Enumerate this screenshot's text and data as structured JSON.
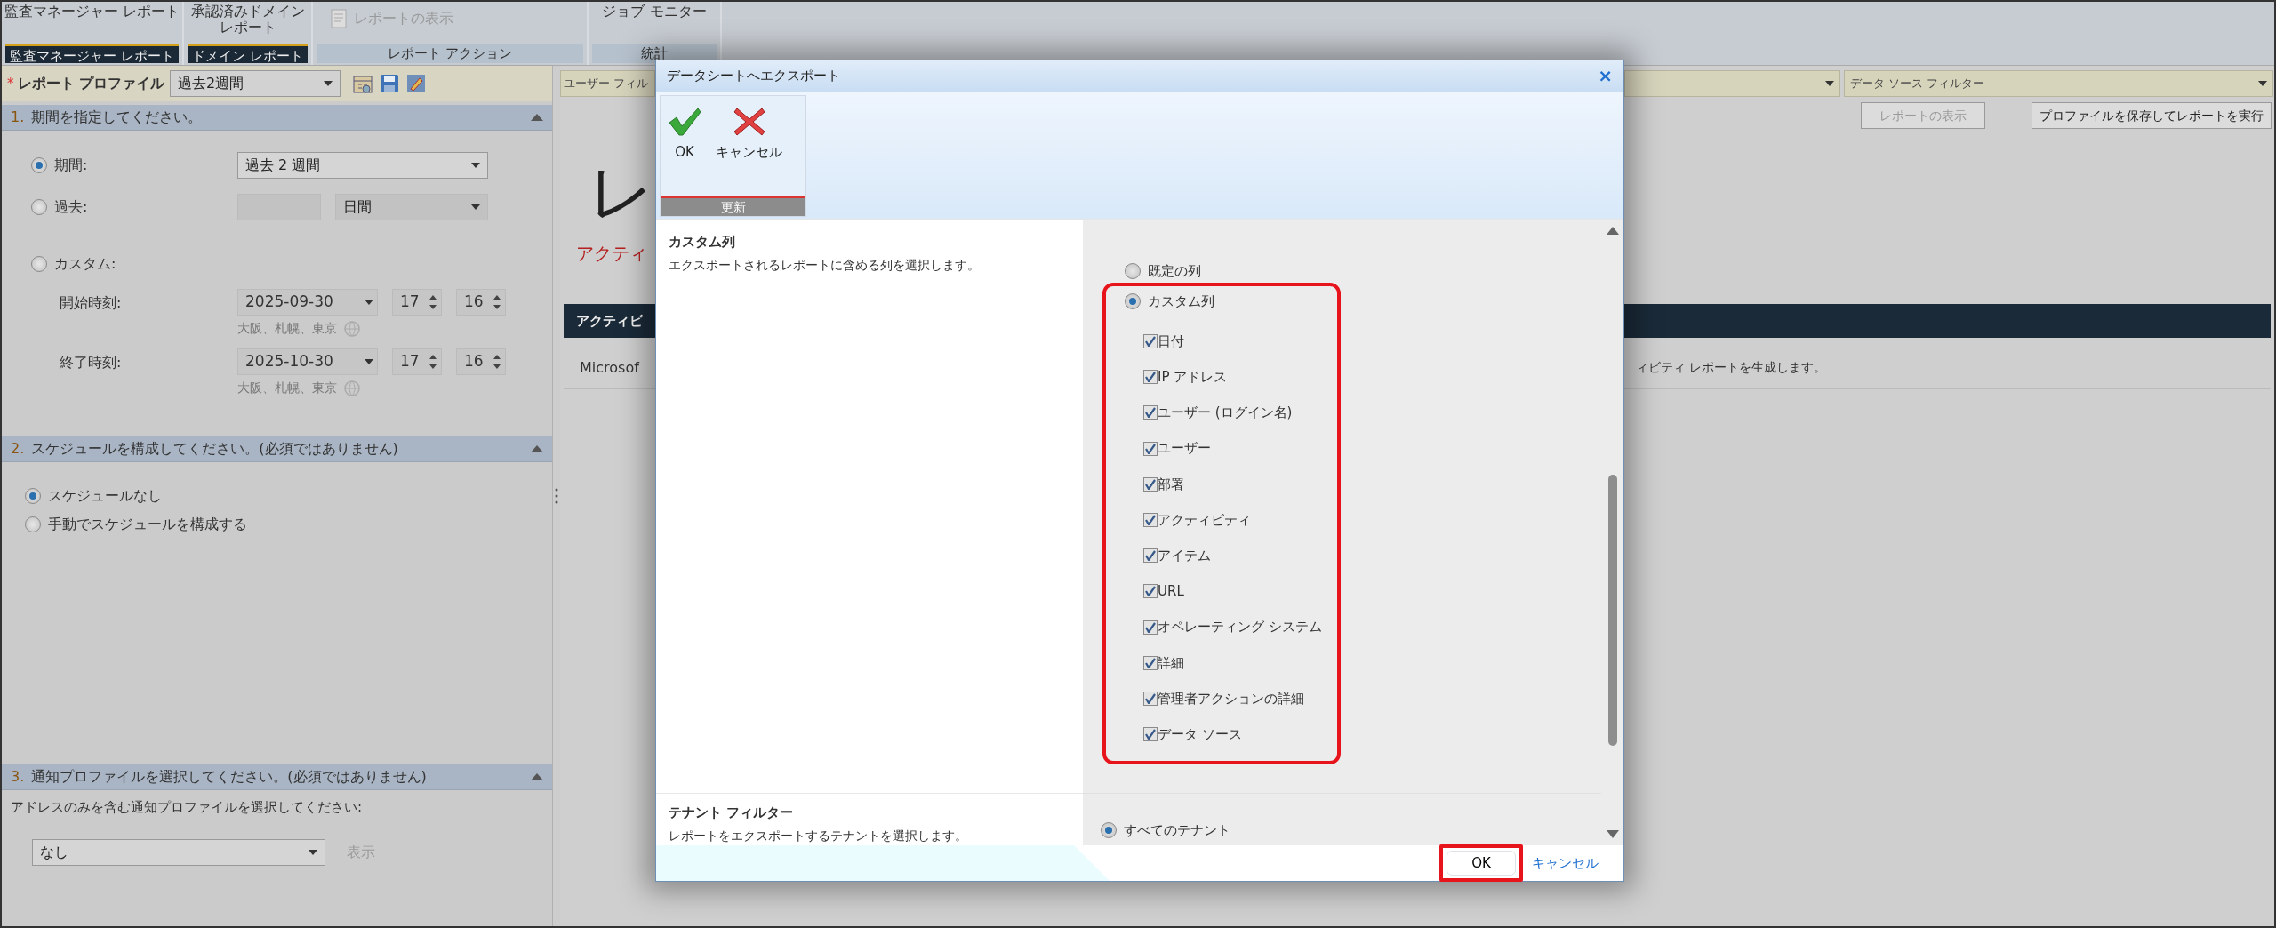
{
  "ribbon": {
    "groups": [
      {
        "kind": "tab",
        "button": "監査マネージャー レポート",
        "label": "監査マネージャー レポート"
      },
      {
        "kind": "tab",
        "button": "承認済みドメインレポート",
        "label": "ドメイン レポート"
      },
      {
        "kind": "action",
        "button": "レポートの表示",
        "label": "レポート アクション",
        "disabled": true
      },
      {
        "kind": "plain",
        "button": "ジョブ モニター",
        "label": "統計"
      }
    ]
  },
  "profile": {
    "required_mark": "*",
    "label": "レポート プロファイル",
    "value": "過去2週間"
  },
  "period_section": {
    "number": "1.",
    "title": "期間を指定してください。",
    "options": [
      {
        "kind": "select",
        "label": "期間:",
        "selected": true,
        "value": "過去 2 週間"
      },
      {
        "kind": "count",
        "label": "過去:",
        "selected": false,
        "unit": "日間"
      },
      {
        "kind": "custom",
        "label": "カスタム:",
        "selected": false
      }
    ],
    "times": [
      {
        "label": "開始時刻:",
        "date": "2025-09-30",
        "hour": "17",
        "minute": "16",
        "timezone": "大阪、札幌、東京"
      },
      {
        "label": "終了時刻:",
        "date": "2025-10-30",
        "hour": "17",
        "minute": "16",
        "timezone": "大阪、札幌、東京"
      }
    ]
  },
  "schedule_section": {
    "number": "2.",
    "title": "スケジュールを構成してください。(必須ではありません)",
    "options": [
      {
        "label": "スケジュールなし",
        "selected": true
      },
      {
        "label": "手動でスケジュールを構成する",
        "selected": false
      }
    ]
  },
  "notification_section": {
    "number": "3.",
    "title": "通知プロファイルを選択してください。(必須ではありません)",
    "prompt": "アドレスのみを含む通知プロファイルを選択してください:",
    "value": "なし",
    "link": {
      "label": "表示",
      "disabled": true
    }
  },
  "main": {
    "filters": [
      "ユーザー フィル",
      "データ ソース フィルター"
    ],
    "buttons": [
      {
        "label": "レポートの表示",
        "disabled": true
      },
      {
        "label": "プロファイルを保存してレポートを実行",
        "disabled": false
      }
    ],
    "title": "レ",
    "subtitle": "アクティ",
    "bar_text": "アクティビ",
    "description": [
      "Microsof",
      "ィビティ レポートを生成します。"
    ]
  },
  "dialog": {
    "title": "データシートへエクスポート",
    "close": "×",
    "toolbar": {
      "buttons": [
        {
          "kind": "ok",
          "label": "OK"
        },
        {
          "kind": "cancel",
          "label": "キャンセル"
        }
      ],
      "group_label": "更新"
    },
    "columns_section": {
      "title": "カスタム列",
      "description": "エクスポートされるレポートに含める列を選択します。",
      "options": [
        {
          "label": "既定の列",
          "selected": false
        },
        {
          "label": "カスタム列",
          "selected": true
        }
      ],
      "columns": [
        {
          "label": "日付",
          "checked": true
        },
        {
          "label": "IP アドレス",
          "checked": true
        },
        {
          "label": "ユーザー (ログイン名)",
          "checked": true
        },
        {
          "label": "ユーザー",
          "checked": true
        },
        {
          "label": "部署",
          "checked": true
        },
        {
          "label": "アクティビティ",
          "checked": true
        },
        {
          "label": "アイテム",
          "checked": true
        },
        {
          "label": "URL",
          "checked": true
        },
        {
          "label": "オペレーティング システム",
          "checked": true
        },
        {
          "label": "詳細",
          "checked": true
        },
        {
          "label": "管理者アクションの詳細",
          "checked": true
        },
        {
          "label": "データ ソース",
          "checked": true
        }
      ]
    },
    "tenant_section": {
      "title": "テナント フィルター",
      "description": "レポートをエクスポートするテナントを選択します。",
      "options": [
        {
          "label": "すべてのテナント",
          "selected": true
        }
      ]
    },
    "footer": {
      "ok": "OK",
      "cancel": "キャンセル"
    }
  }
}
